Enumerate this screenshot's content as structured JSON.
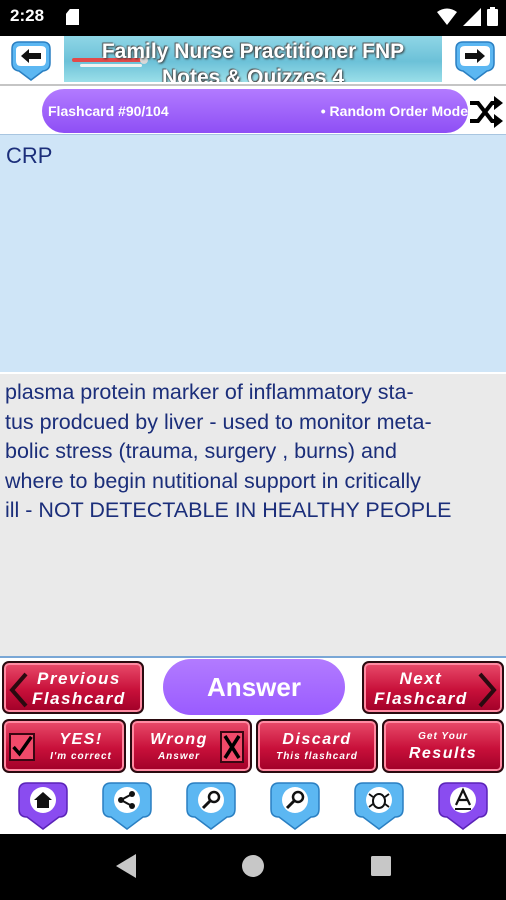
{
  "status_bar": {
    "time": "2:28"
  },
  "header": {
    "banner_title_line1": "Family Nurse Practitioner FNP",
    "banner_title_line2": "Notes & Quizzes 4"
  },
  "title_bar": {
    "flashcard_label": "Flashcard #90/104",
    "mode_label": "• Random Order Mode"
  },
  "card": {
    "question": "CRP",
    "answer_lines": [
      "plasma protein marker of inflammatory sta-",
      "tus prodcued by liver - used to monitor meta-",
      "bolic stress (trauma, surgery , burns) and",
      "where to begin nutitional support in critically",
      "ill - NOT DETECTABLE IN HEALTHY PEOPLE"
    ]
  },
  "actions": {
    "previous": [
      "Previous",
      "Flashcard"
    ],
    "answer": "Answer",
    "next": [
      "Next",
      "Flashcard"
    ],
    "yes": [
      "YES!",
      "I'm correct"
    ],
    "wrong": [
      "Wrong",
      "Answer"
    ],
    "discard": [
      "Discard",
      "This flashcard"
    ],
    "results": [
      "Get Your",
      "Results"
    ]
  },
  "icons": {
    "header_left": "arrow-left-icon",
    "header_right": "arrow-right-icon",
    "shuffle": "shuffle-icon",
    "bottom": [
      "home-icon",
      "share-icon",
      "search-icon",
      "search-icon",
      "bug-icon",
      "font-icon"
    ]
  },
  "colors": {
    "purple_accent": "#9a5bff",
    "red_button": "#c8103a",
    "question_bg": "#cfe5f7",
    "answer_bg": "#eaeaea",
    "text_blue": "#1b2e7a"
  }
}
